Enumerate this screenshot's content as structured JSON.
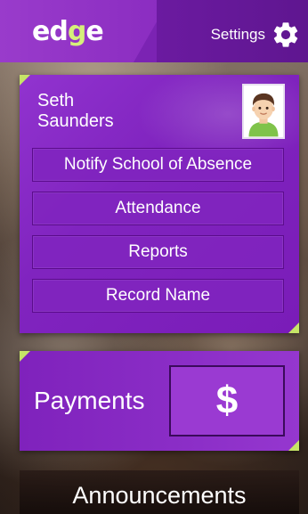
{
  "header": {
    "logo_prefix": "ed",
    "logo_accent": "g",
    "logo_suffix": "e",
    "settings_label": "Settings",
    "settings_icon": "gear-icon"
  },
  "student": {
    "first_name": "Seth",
    "last_name": "Saunders",
    "avatar_icon": "student-avatar",
    "menu": [
      {
        "label": "Notify School of Absence"
      },
      {
        "label": "Attendance"
      },
      {
        "label": "Reports"
      },
      {
        "label": "Record Name"
      }
    ]
  },
  "payments": {
    "label": "Payments",
    "button_symbol": "$"
  },
  "announcements": {
    "label": "Announcements"
  },
  "colors": {
    "header_purple": "#7b23b3",
    "card_purple": "#8024bf",
    "accent_green": "#c6e567",
    "logo_green": "#d6f07a"
  }
}
